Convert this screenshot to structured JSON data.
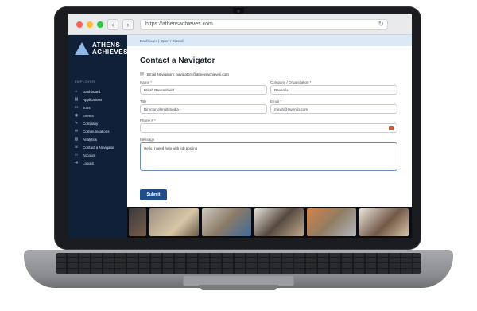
{
  "browser": {
    "url": "https://athensachieves.com",
    "back_icon": "‹",
    "forward_icon": "›",
    "reload_icon": "↻"
  },
  "sidebar": {
    "logo_line1": "ATHENS",
    "logo_line2": "ACHIEVES",
    "section_label": "EMPLOYER",
    "items": [
      {
        "icon": "⌂",
        "label": "Dashboard"
      },
      {
        "icon": "▤",
        "label": "Applications"
      },
      {
        "icon": "▭",
        "label": "Jobs"
      },
      {
        "icon": "◉",
        "label": "Events"
      },
      {
        "icon": "✎",
        "label": "Company"
      },
      {
        "icon": "✉",
        "label": "Communications"
      },
      {
        "icon": "▥",
        "label": "Analytics"
      },
      {
        "icon": "☏",
        "label": "Contact a Navigator"
      },
      {
        "icon": "⚇",
        "label": "Account"
      },
      {
        "icon": "⇥",
        "label": "Logout"
      }
    ]
  },
  "main": {
    "breadcrumb": "Dashboard | Open / Closed",
    "title": "Contact a Navigator",
    "email_note": "Email Navigators: navigators@athensachieves.com",
    "fields": {
      "name": {
        "label": "Name *",
        "value": "Micah Ravenshield"
      },
      "company": {
        "label": "Company / Organization *",
        "value": "Ravenfix"
      },
      "title": {
        "label": "Title",
        "value": "Director of multimedia"
      },
      "email": {
        "label": "Email *",
        "value": "micah@ravenfix.com"
      },
      "phone": {
        "label": "Phone # *",
        "value": ""
      },
      "message": {
        "label": "Message",
        "value": "Hello, I need help with job posting"
      }
    },
    "submit_label": "Submit"
  }
}
